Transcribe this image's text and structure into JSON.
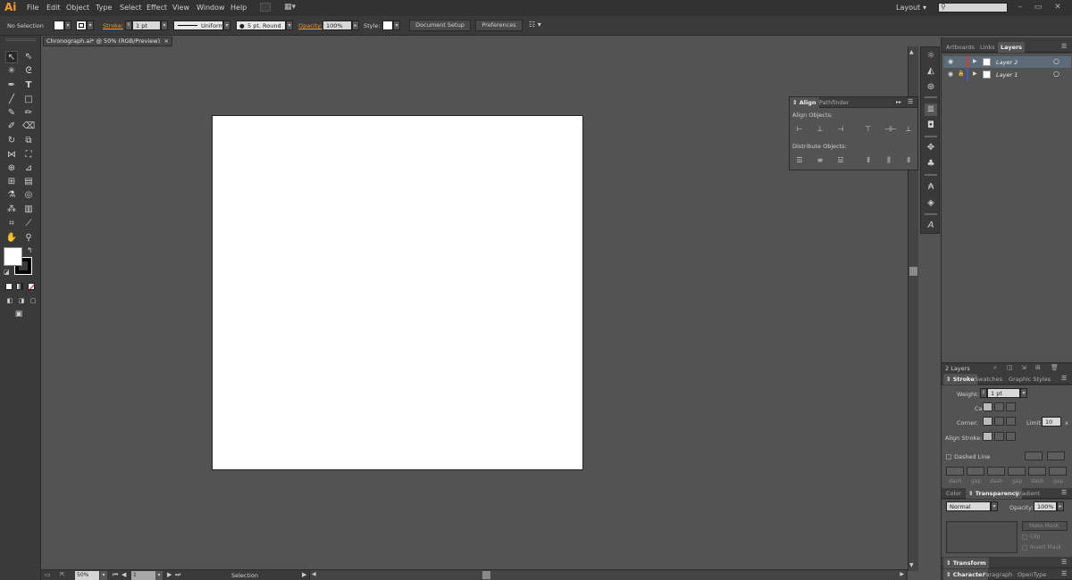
{
  "app": {
    "logo": "Ai"
  },
  "menu": [
    "File",
    "Edit",
    "Object",
    "Type",
    "Select",
    "Effect",
    "View",
    "Window",
    "Help"
  ],
  "workspace": {
    "label": "Layout"
  },
  "control": {
    "selection": "No Selection",
    "stroke_label": "Stroke:",
    "stroke_weight": "1 pt",
    "profile": "Uniform",
    "brush": "5 pt. Round",
    "opacity_label": "Opacity:",
    "opacity": "100%",
    "style_label": "Style:",
    "doc_setup": "Document Setup",
    "preferences": "Preferences"
  },
  "document": {
    "tab": "Chronograph.ai* @ 50% (RGB/Preview)"
  },
  "status": {
    "zoom": "50%",
    "artboard": "1",
    "tool": "Selection"
  },
  "align_panel": {
    "tabs": [
      "Align",
      "Pathfinder"
    ],
    "align_objects": "Align Objects:",
    "distribute_objects": "Distribute Objects:"
  },
  "layers_panel": {
    "tabs": [
      "Artboards",
      "Links",
      "Layers"
    ],
    "layers": [
      {
        "name": "Layer 2",
        "color": "#d63a3a"
      },
      {
        "name": "Layer 1",
        "color": "#3a5ad6"
      }
    ],
    "count": "2 Layers"
  },
  "stroke_panel": {
    "tabs": [
      "Stroke",
      "Swatches",
      "Graphic Styles"
    ],
    "weight_label": "Weight:",
    "weight": "1 pt",
    "cap_label": "Cap:",
    "corner_label": "Corner:",
    "limit_label": "Limit:",
    "limit": "10",
    "limit_unit": "x",
    "align_label": "Align Stroke:",
    "dashed_label": "Dashed Line",
    "dash_labels": [
      "dash",
      "gap",
      "dash",
      "gap",
      "dash",
      "gap"
    ]
  },
  "transparency_panel": {
    "tabs": [
      "Color",
      "Transparency",
      "Gradient"
    ],
    "blend": "Normal",
    "opacity_label": "Opacity:",
    "opacity": "100%",
    "make_mask": "Make Mask",
    "clip": "Clip",
    "invert": "Invert Mask"
  },
  "transform_panel": {
    "tab": "Transform"
  },
  "character_panel": {
    "tabs": [
      "Character",
      "Paragraph",
      "OpenType"
    ]
  }
}
